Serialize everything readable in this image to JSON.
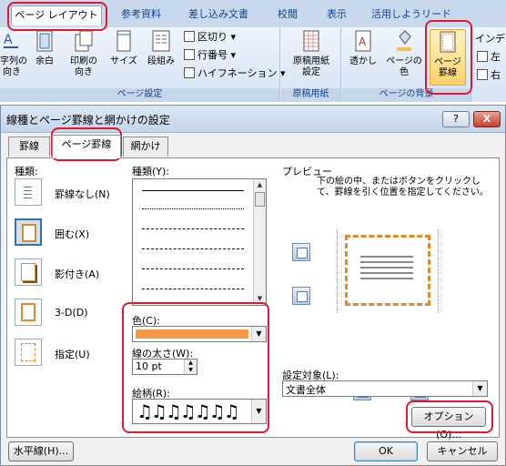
{
  "ribbon": {
    "tabs": [
      "ページ レイアウト",
      "参考資料",
      "差し込み文書",
      "校閲",
      "表示",
      "活用しようリード"
    ],
    "buttons": {
      "text_direction": "字列の\n向き",
      "margins": "余白",
      "orientation": "印刷の\n向き",
      "size": "サイズ",
      "columns": "段組み",
      "breaks": "区切り",
      "line_numbers": "行番号",
      "hyphenation": "ハイフネーション",
      "manuscript": "原稿用紙\n設定",
      "watermark": "透かし",
      "page_color": "ページの\n色",
      "page_borders": "ページ\n罫線",
      "indent": "インデン",
      "left": "左",
      "right": "右"
    },
    "groups": {
      "page_setup": "ページ設定",
      "manuscript_paper": "原稿用紙",
      "page_background": "ページの背景"
    }
  },
  "dialog": {
    "title": "線種とページ罫線と網かけの設定",
    "help": "?",
    "close": "X",
    "tabs": [
      "罫線",
      "ページ罫線",
      "網かけ"
    ],
    "setting": {
      "label": "種類:",
      "items": [
        "罫線なし(N)",
        "囲む(X)",
        "影付き(A)",
        "3-D(D)",
        "指定(U)"
      ]
    },
    "style": {
      "label": "種類(Y):"
    },
    "color": {
      "label": "色(C):",
      "value": "#f79646"
    },
    "width": {
      "label": "線の太さ(W):",
      "value": "10 pt"
    },
    "art": {
      "label": "絵柄(R):",
      "value": "♫♫♫♫♫♫♫"
    },
    "preview": {
      "label": "プレビュー",
      "hint": "下の絵の中、またはボタンをクリックして、罫線を引く位置を指定してください。"
    },
    "apply_to": {
      "label": "設定対象(L):",
      "value": "文書全体"
    },
    "buttons": {
      "options": "オプション(O)...",
      "horizontal_line": "水平線(H)...",
      "ok": "OK",
      "cancel": "キャンセル"
    }
  }
}
